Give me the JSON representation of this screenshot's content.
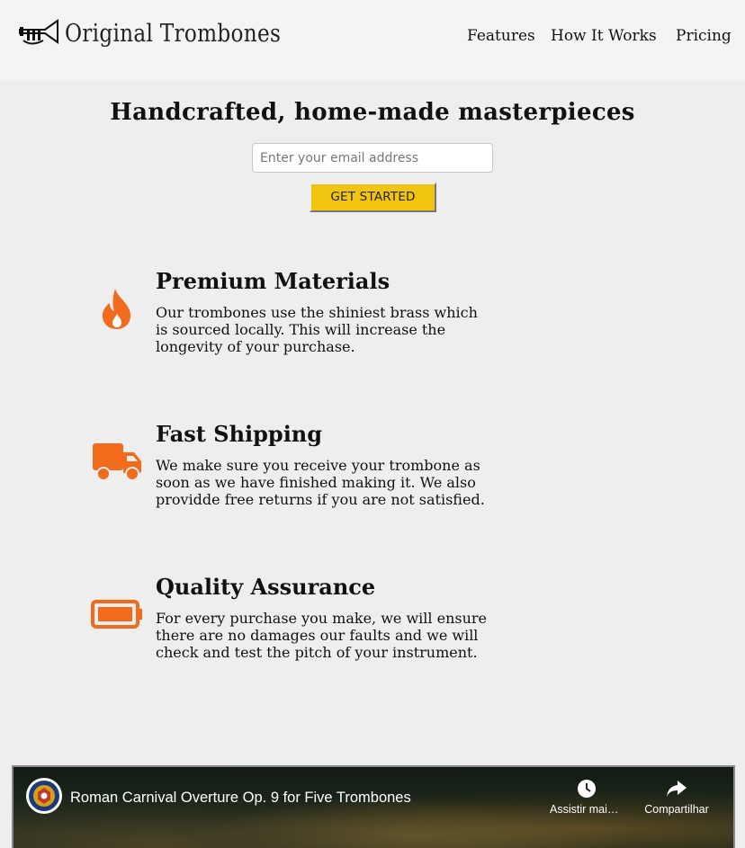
{
  "header": {
    "logo_text": "Original Trombones",
    "nav": [
      {
        "label": "Features"
      },
      {
        "label": "How It Works"
      },
      {
        "label": "Pricing"
      }
    ]
  },
  "hero": {
    "title": "Handcrafted, home-made masterpieces",
    "email_placeholder": "Enter your email address",
    "cta_label": "GET STARTED"
  },
  "features": [
    {
      "icon": "fire-icon",
      "title": "Premium Materials",
      "description": "Our trombones use the shiniest brass which is sourced locally. This will increase the longevity of your purchase."
    },
    {
      "icon": "truck-icon",
      "title": "Fast Shipping",
      "description": "We make sure you receive your trombone as soon as we have finished making it. We also providde free returns if you are not satisfied."
    },
    {
      "icon": "battery-full-icon",
      "title": "Quality Assurance",
      "description": "For every purchase you make, we will ensure there are no damages our faults and we will check and test the pitch of your instrument."
    }
  ],
  "video": {
    "title": "Roman Carnival Overture Op. 9 for Five Trombones",
    "actions": [
      {
        "icon": "clock-icon",
        "label": "Assistir mais tarde"
      },
      {
        "icon": "share-icon",
        "label": "Compartilhar"
      }
    ]
  },
  "colors": {
    "accent": "#f1c40f",
    "icon_orange": "#f26b1d",
    "background": "#eeeeee"
  }
}
